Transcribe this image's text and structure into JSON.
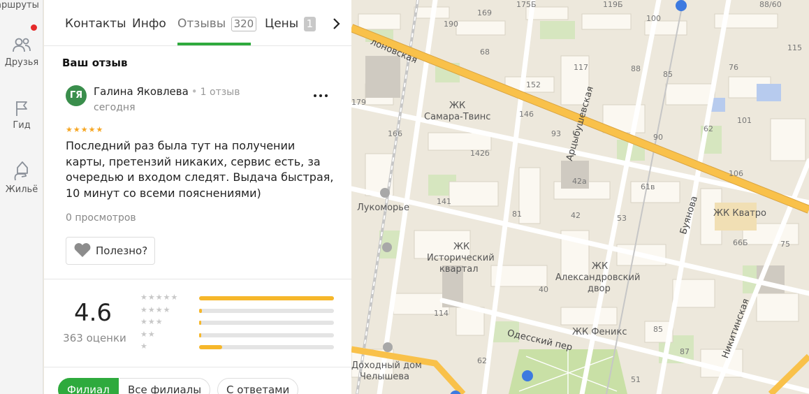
{
  "rail": {
    "top_label": "аршруты",
    "items": [
      {
        "label": "Друзья",
        "icon": "friends-icon"
      },
      {
        "label": "Гид",
        "icon": "flag-icon"
      },
      {
        "label": "Жильё",
        "icon": "house-hand-icon"
      }
    ]
  },
  "tabs": [
    {
      "label": "Контакты"
    },
    {
      "label": "Инфо"
    },
    {
      "label": "Отзывы",
      "count": "320"
    },
    {
      "label": "Цены",
      "count": "1"
    }
  ],
  "review": {
    "section_title": "Ваш отзыв",
    "avatar_initials": "ГЯ",
    "author": "Галина Яковлева",
    "author_meta": "1 отзыв",
    "date": "сегодня",
    "stars": "★★★★★",
    "text": "Последний раз была тут на получении карты, претензий никаких, сервис есть, за очередью и входом следят. Выдача быстрая, 10 минут со всеми пояснениями)",
    "views": "0 просмотров",
    "useful_label": "Полезно?"
  },
  "rating": {
    "value": "4.6",
    "count_label": "363 оценки",
    "distribution": [
      {
        "stars": "★★★★★",
        "fraction": 1.0
      },
      {
        "stars": "★★★★",
        "fraction": 0.02
      },
      {
        "stars": "★★★",
        "fraction": 0.01
      },
      {
        "stars": "★★",
        "fraction": 0.015
      },
      {
        "stars": "★",
        "fraction": 0.17
      }
    ]
  },
  "filters": [
    {
      "label": "Филиал"
    },
    {
      "label": "Все филиалы"
    },
    {
      "label": "С ответами"
    }
  ],
  "map": {
    "labels": {
      "street1": "лоновская",
      "street2": "Арцыбушевская",
      "street3": "Буянова",
      "street4": "Никитинская",
      "street5": "Одесский пер",
      "zk1a": "ЖК",
      "zk1b": "Самара-Твинс",
      "zk2a": "ЖК",
      "zk2b": "Исторический",
      "zk2c": "квартал",
      "zk3a": "ЖК",
      "zk3b": "Александровский",
      "zk3c": "двор",
      "zk4": "ЖК Феникс",
      "zk5": "ЖК Кватро",
      "poi1": "Лукоморье",
      "poi2a": "Доходный дом",
      "poi2b": "Челышева",
      "n1": "169",
      "n2": "175Б",
      "n3": "119Б",
      "n4": "100",
      "n5": "88/60",
      "n6": "190",
      "n7": "68",
      "n8": "117",
      "n9": "88",
      "n10": "76",
      "n11": "115",
      "n12": "85",
      "n13": "152",
      "n14": "179",
      "n15": "146",
      "n16": "93",
      "n17": "90",
      "n18": "62",
      "n19": "101",
      "n20": "166",
      "n21": "142б",
      "n22": "106",
      "n23": "42а",
      "n24": "61в",
      "n25": "141",
      "n26": "81",
      "n27": "42",
      "n28": "53",
      "n29": "66Б",
      "n30": "75",
      "n31": "40",
      "n32": "114",
      "n33": "85",
      "n34": "87",
      "n35": "62",
      "n36": "51"
    }
  }
}
